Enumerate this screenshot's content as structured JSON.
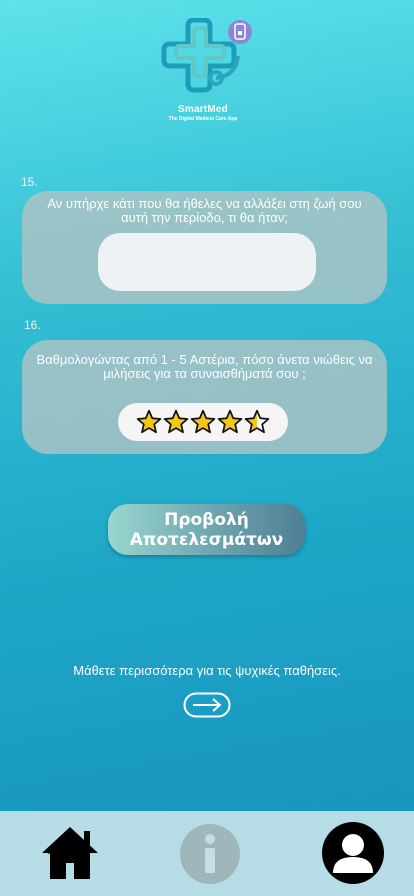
{
  "app": {
    "name": "SmartMed",
    "tagline": "The Digital Medical Care App"
  },
  "questions": [
    {
      "number": "15.",
      "text": "Αν υπήρχε κάτι που θα ήθελες να αλλάξει στη ζωή σου αυτή την περίοδο, τι θα ήταν;",
      "answer_value": ""
    },
    {
      "number": "16.",
      "text": "Βαθμολογώντας από  1 - 5 Αστέρια, πόσο άνετα νιώθεις να μιλήσεις για τα συναισθήματά σου ;",
      "rating": 4.5,
      "rating_max": 5
    }
  ],
  "results_button": {
    "line1": "Προβολή",
    "line2": "Αποτελεσμάτων"
  },
  "learn_more": {
    "text": "Μάθετε περισσότερα για τις ψυχικές παθήσεις."
  },
  "nav": {
    "items": [
      "home-icon",
      "info-icon",
      "profile-icon"
    ]
  },
  "colors": {
    "star": "#f5c518",
    "nav_bg": "#b6dce5",
    "card_bg": "#afc3c3"
  }
}
